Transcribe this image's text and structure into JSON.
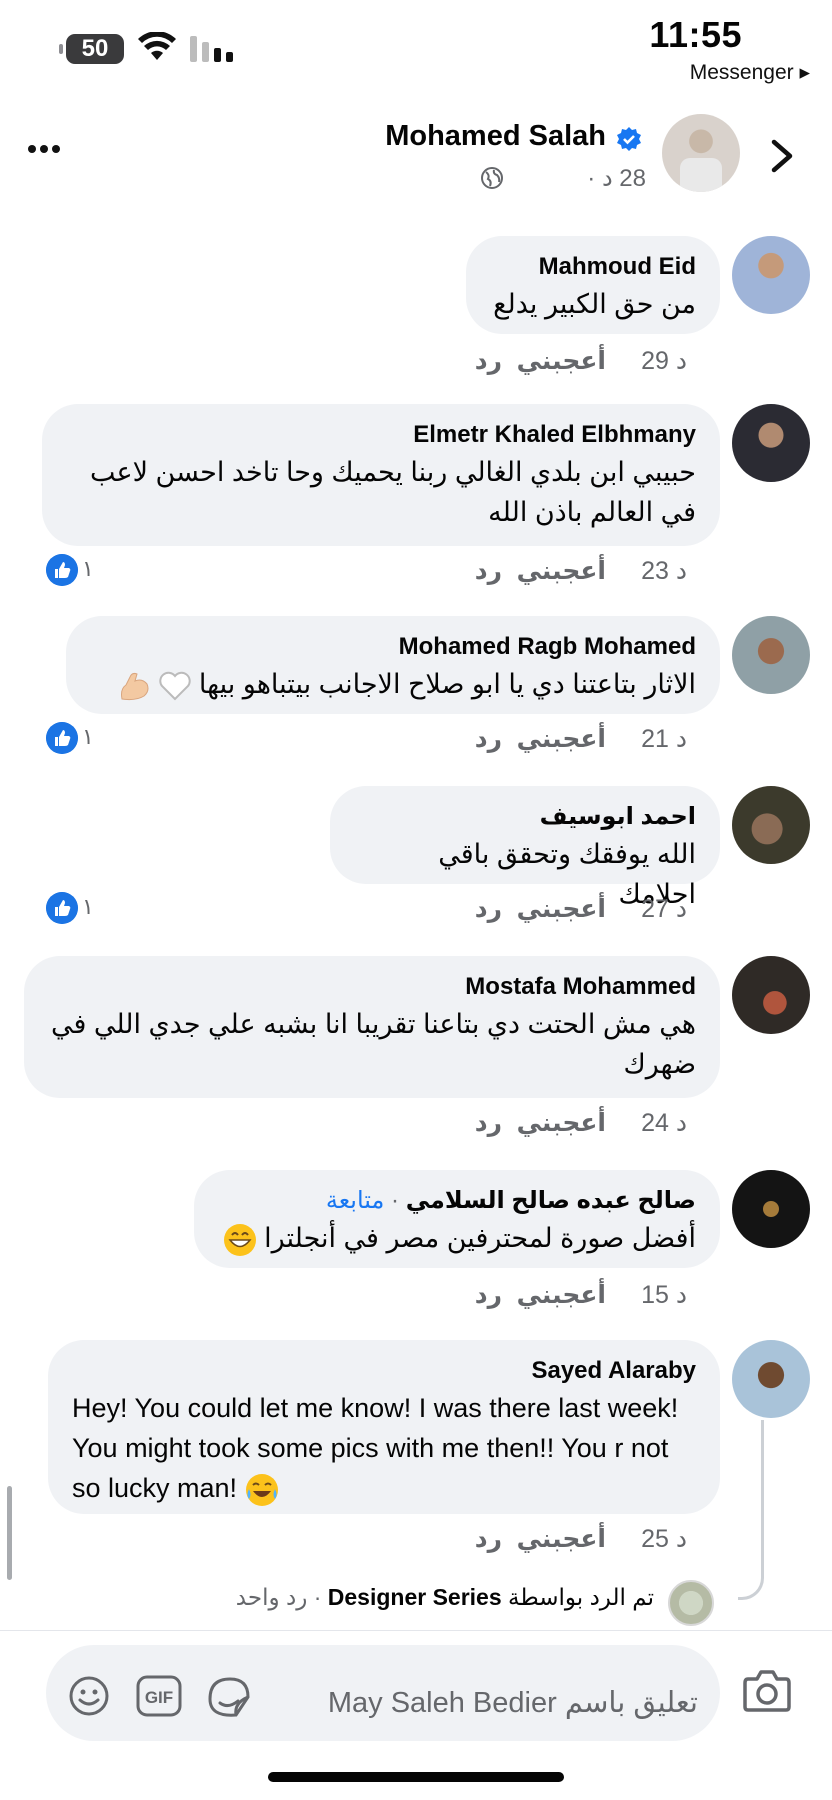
{
  "status_bar": {
    "battery": "50",
    "time": "11:55",
    "back_app": "Messenger ▸"
  },
  "header": {
    "author": "Mohamed Salah",
    "time": "28 د ·"
  },
  "comments": [
    {
      "name": "Mahmoud Eid",
      "text": "من حق الكبير يدلع",
      "time": "29 د",
      "like": "أعجبني",
      "reply": "رد"
    },
    {
      "name": "Elmetr Khaled Elbhmany",
      "text": "حبيبي ابن بلدي الغالي ربنا يحميك وحا تاخد احسن لاعب في العالم باذن الله",
      "time": "23 د",
      "like": "أعجبني",
      "reply": "رد",
      "reactions": "١"
    },
    {
      "name": "Mohamed Ragb Mohamed",
      "text": "الاثار بتاعتنا دي يا ابو صلاح الاجانب بيتباهو بيها",
      "time": "21 د",
      "like": "أعجبني",
      "reply": "رد",
      "reactions": "١"
    },
    {
      "name": "احمد ابوسيف",
      "text": "الله يوفقك وتحقق باقي احلامك",
      "time": "27 د",
      "like": "أعجبني",
      "reply": "رد",
      "reactions": "١"
    },
    {
      "name": "Mostafa Mohammed",
      "text": "هي مش الحتت دي بتاعنا تقريبا انا بشبه علي جدي اللي في ضهرك",
      "time": "24 د",
      "like": "أعجبني",
      "reply": "رد"
    },
    {
      "name": "صالح عبده صالح السلامي",
      "follow": "متابعة",
      "text": "أفضل صورة لمحترفين مصر في أنجلترا",
      "time": "15 د",
      "like": "أعجبني",
      "reply": "رد"
    },
    {
      "name": "Sayed Alaraby",
      "text": "Hey! You could let me know! I was there last week! You might took some pics with me then!! You r not so lucky man!",
      "time": "25 د",
      "like": "أعجبني",
      "reply": "رد"
    }
  ],
  "replies_summary": {
    "prefix": "تم الرد بواسطة",
    "name": "Designer Series",
    "count": "· رد واحد"
  },
  "composer": {
    "placeholder": "تعليق باسم May Saleh Bedier"
  },
  "colors": {
    "accent": "#1877f2",
    "bubble": "#f0f2f5",
    "muted": "#65676b"
  }
}
